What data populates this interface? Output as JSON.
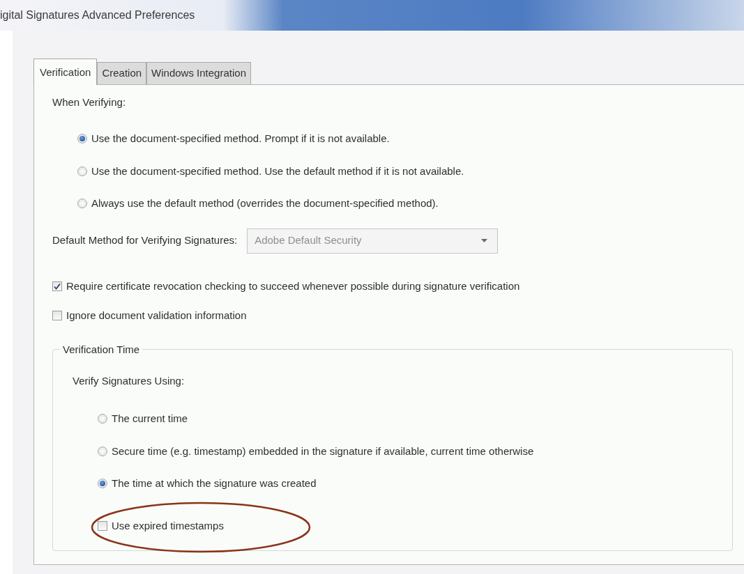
{
  "window": {
    "title": "igital Signatures Advanced Preferences"
  },
  "tabs": [
    {
      "label": "Verification",
      "selected": true
    },
    {
      "label": "Creation",
      "selected": false
    },
    {
      "label": "Windows Integration",
      "selected": false
    }
  ],
  "when_verifying": {
    "label": "When Verifying:",
    "options": [
      {
        "label": "Use the document-specified method. Prompt if it is not available.",
        "selected": true
      },
      {
        "label": "Use the document-specified method. Use the default method if it is not available.",
        "selected": false
      },
      {
        "label": "Always use the default method (overrides the document-specified method).",
        "selected": false
      }
    ]
  },
  "default_method": {
    "label": "Default Method for Verifying Signatures:",
    "value": "Adobe Default Security",
    "disabled": true
  },
  "checkboxes": [
    {
      "label": "Require certificate revocation checking to succeed whenever possible during signature verification",
      "checked": true
    },
    {
      "label": "Ignore document validation information",
      "checked": false
    }
  ],
  "verification_time": {
    "legend": "Verification Time",
    "label": "Verify Signatures Using:",
    "options": [
      {
        "label": "The current time",
        "selected": false
      },
      {
        "label": "Secure time (e.g. timestamp) embedded in the signature if available, current time otherwise",
        "selected": false
      },
      {
        "label": "The time at which the signature was created",
        "selected": true
      }
    ],
    "checkboxes": [
      {
        "label": "Use expired timestamps",
        "checked": false,
        "circled": true
      }
    ]
  }
}
